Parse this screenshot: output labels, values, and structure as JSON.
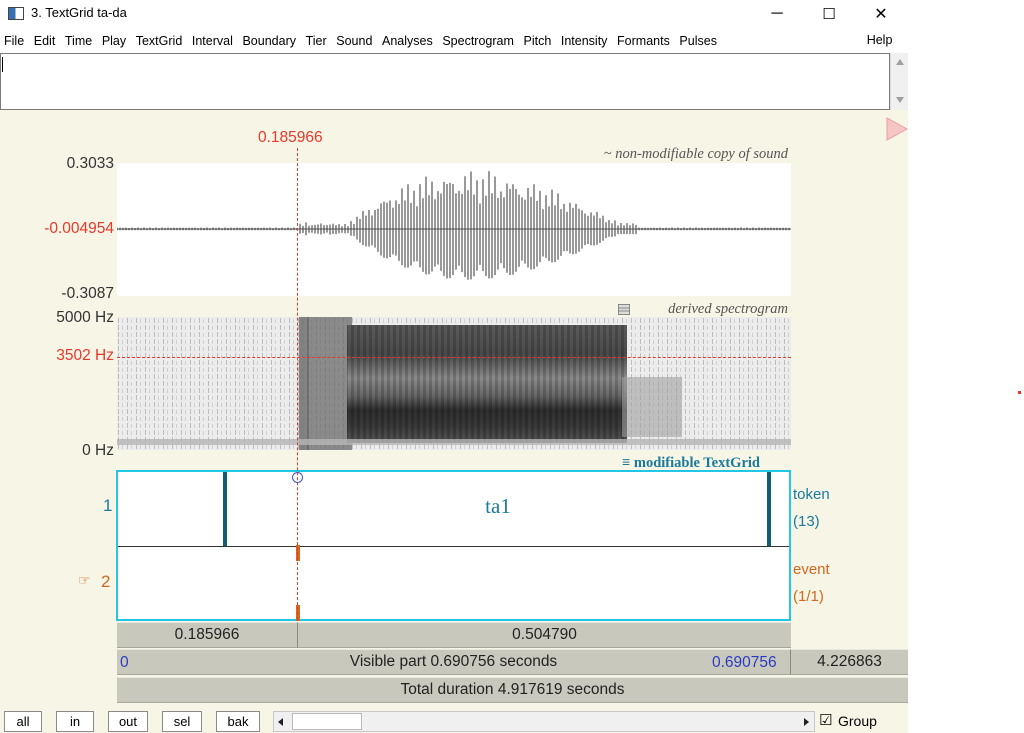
{
  "window": {
    "title": "3. TextGrid ta-da",
    "minimize": "─",
    "maximize": "☐",
    "close": "✕"
  },
  "menu": [
    "File",
    "Edit",
    "Time",
    "Play",
    "TextGrid",
    "Interval",
    "Boundary",
    "Tier",
    "Sound",
    "Analyses",
    "Spectrogram",
    "Pitch",
    "Intensity",
    "Formants",
    "Pulses"
  ],
  "menu_help": "Help",
  "cursor_time": "0.185966",
  "waveform": {
    "max": "0.3033",
    "cursor_value": "-0.004954",
    "min": "-0.3087",
    "caption": "~ non-modifiable copy of sound"
  },
  "spectrogram": {
    "top": "5000 Hz",
    "cursor_value": "3502 Hz",
    "bottom": "0 Hz",
    "caption": "derived spectrogram"
  },
  "textgrid": {
    "caption": "modifiable TextGrid",
    "tiers": [
      {
        "number": "1",
        "name": "token",
        "count": "(13)",
        "label": "ta1",
        "color": "#1a7a9c"
      },
      {
        "number": "2",
        "name": "event",
        "count": "(1/1)",
        "label": "",
        "color": "#d2691e",
        "pointer": "☞"
      }
    ]
  },
  "timebars": {
    "left_segment": "0.185966",
    "right_segment": "0.504790",
    "start": "0",
    "visible_part": "Visible part 0.690756 seconds",
    "end": "0.690756",
    "after": "4.226863",
    "total": "Total duration 4.917619 seconds"
  },
  "toolbar": {
    "buttons": [
      "all",
      "in",
      "out",
      "sel",
      "bak"
    ],
    "group_check": "☑",
    "group_label": "Group"
  }
}
